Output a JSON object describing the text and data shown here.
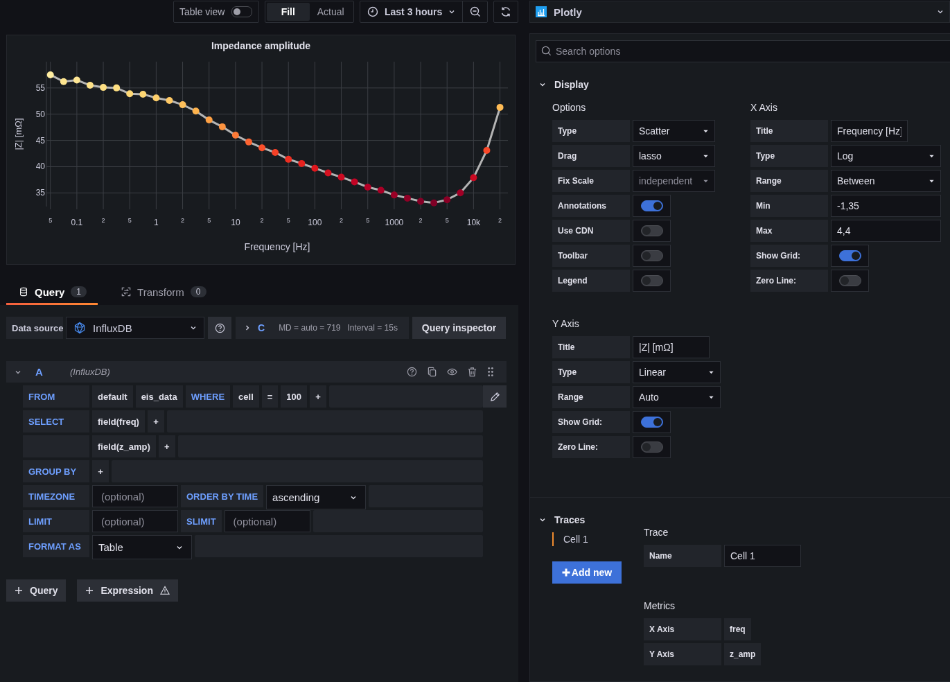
{
  "toolbar": {
    "table_view": {
      "label": "Table view",
      "on": false
    },
    "view_modes": [
      {
        "label": "Fill",
        "selected": true
      },
      {
        "label": "Actual",
        "selected": false
      }
    ],
    "time_range": "Last 3 hours"
  },
  "panel": {
    "title": "Impedance amplitude",
    "chart_data": {
      "type": "line",
      "xlabel": "Frequency [Hz]",
      "ylabel": "|Z| [mΩ]",
      "categories": [
        "5",
        null,
        "0.1",
        null,
        "2",
        null,
        "5",
        null,
        "1",
        null,
        "2",
        null,
        "5",
        null,
        "10",
        null,
        "2",
        null,
        "5",
        null,
        "100",
        null,
        "2",
        null,
        "5",
        null,
        "1000",
        null,
        "2",
        null,
        "5",
        null,
        "10k",
        null,
        "2"
      ],
      "values": [
        57.5,
        56.2,
        56.5,
        55.5,
        55.1,
        55.0,
        53.9,
        53.8,
        53.1,
        52.6,
        51.8,
        50.6,
        48.9,
        47.6,
        46.0,
        44.7,
        43.6,
        42.7,
        41.4,
        40.6,
        39.7,
        38.8,
        38.0,
        37.1,
        36.1,
        35.5,
        34.6,
        34.0,
        33.4,
        33.1,
        33.7,
        35.0,
        37.9,
        43.1,
        51.3
      ],
      "ylim": [
        32.4,
        60
      ],
      "grid": true,
      "marker": "circle",
      "yticks": [
        35,
        40,
        45,
        50,
        55
      ]
    }
  },
  "query_tabs": [
    {
      "label": "Query",
      "count": "1",
      "selected": true
    },
    {
      "label": "Transform",
      "count": "0",
      "selected": false
    }
  ],
  "data_source": {
    "label": "Data source",
    "value": "InfluxDB"
  },
  "query_options": {
    "title": "C",
    "max_data_points": "MD = auto = 719",
    "interval": "Interval = 15s"
  },
  "query_inspector": "Query inspector",
  "query": {
    "ref": "A",
    "source": "(InfluxDB)",
    "expanded": true,
    "rows": [
      {
        "keyword": "FROM",
        "editable": true,
        "segments": [
          {
            "kind": "value",
            "text": "default"
          },
          {
            "kind": "value",
            "text": "eis_data"
          },
          {
            "kind": "keyword",
            "text": "WHERE"
          },
          {
            "kind": "value",
            "text": "cell"
          },
          {
            "kind": "value",
            "text": "="
          },
          {
            "kind": "value",
            "text": "100"
          },
          {
            "kind": "plus",
            "text": "+"
          }
        ]
      },
      {
        "keyword": "SELECT",
        "editable": false,
        "segments": [
          {
            "kind": "value",
            "text": "field(freq)"
          },
          {
            "kind": "plus",
            "text": "+"
          }
        ]
      },
      {
        "editable": false,
        "segments": [
          {
            "kind": "value",
            "text": "field(z_amp)"
          },
          {
            "kind": "plus",
            "text": "+"
          }
        ]
      },
      {
        "keyword": "GROUP BY",
        "editable": false,
        "segments": [
          {
            "kind": "plus",
            "text": "+"
          }
        ]
      },
      {
        "keyword": "TIMEZONE",
        "editable": false,
        "segments": [
          {
            "kind": "input",
            "placeholder": "(optional)"
          },
          {
            "kind": "keyword",
            "text": "ORDER BY TIME"
          },
          {
            "kind": "select",
            "text": "ascending"
          }
        ]
      },
      {
        "keyword": "LIMIT",
        "editable": false,
        "segments": [
          {
            "kind": "input",
            "placeholder": "(optional)"
          },
          {
            "kind": "keyword",
            "text": "SLIMIT"
          },
          {
            "kind": "input",
            "placeholder": "(optional)"
          }
        ]
      },
      {
        "keyword": "FORMAT AS",
        "editable": false,
        "segments": [
          {
            "kind": "select",
            "text": "Table"
          }
        ]
      }
    ]
  },
  "add_buttons": [
    {
      "label": "Query",
      "warning": false
    },
    {
      "label": "Expression",
      "warning": true
    }
  ],
  "visualization": {
    "name": "Plotly"
  },
  "search": {
    "placeholder": "Search options"
  },
  "display": {
    "title": "Display",
    "expanded": true,
    "groups": [
      {
        "title": "Options",
        "fields": [
          {
            "label": "Type",
            "kind": "select",
            "value": "Scatter",
            "disabled": false
          },
          {
            "label": "Drag",
            "kind": "select",
            "value": "lasso",
            "disabled": false
          },
          {
            "label": "Fix Scale",
            "kind": "select",
            "value": "independent",
            "disabled": true
          },
          {
            "label": "Annotations",
            "kind": "switch",
            "on": true,
            "disabled": false
          },
          {
            "label": "Use CDN",
            "kind": "switch",
            "on": false,
            "disabled": false
          },
          {
            "label": "Toolbar",
            "kind": "switch",
            "on": false,
            "disabled": false
          },
          {
            "label": "Legend",
            "kind": "switch",
            "on": false,
            "disabled": false
          }
        ]
      },
      {
        "title": "X Axis",
        "fields": [
          {
            "label": "Title",
            "kind": "text",
            "value": "Frequency [Hz]",
            "disabled": false
          },
          {
            "label": "Type",
            "kind": "select",
            "value": "Log",
            "disabled": false
          },
          {
            "label": "Range",
            "kind": "select",
            "value": "Between",
            "disabled": false
          },
          {
            "label": "Min",
            "kind": "number",
            "value": "-1,35",
            "disabled": false
          },
          {
            "label": "Max",
            "kind": "number",
            "value": "4,4",
            "disabled": false
          },
          {
            "label": "Show Grid:",
            "kind": "switch",
            "on": true,
            "disabled": false
          },
          {
            "label": "Zero Line:",
            "kind": "switch",
            "on": false,
            "disabled": false
          }
        ]
      },
      {
        "title": "Y Axis",
        "fields": [
          {
            "label": "Title",
            "kind": "text",
            "value": "|Z| [mΩ]",
            "disabled": false
          },
          {
            "label": "Type",
            "kind": "select",
            "value": "Linear",
            "disabled": false
          },
          {
            "label": "Range",
            "kind": "select",
            "value": "Auto",
            "disabled": false
          },
          {
            "label": "Show Grid:",
            "kind": "switch",
            "on": true,
            "disabled": false
          },
          {
            "label": "Zero Line:",
            "kind": "switch",
            "on": false,
            "disabled": false
          }
        ]
      }
    ]
  },
  "traces": {
    "title": "Traces",
    "expanded": true,
    "items": [
      {
        "label": "Cell 1",
        "selected": true
      }
    ],
    "add_button": "Add new",
    "trace_title": "Trace",
    "name": {
      "label": "Name",
      "value": "Cell 1"
    },
    "metrics_title": "Metrics",
    "metrics": [
      {
        "label": "X Axis",
        "value": "freq"
      },
      {
        "label": "Y Axis",
        "value": "z_amp"
      }
    ]
  }
}
